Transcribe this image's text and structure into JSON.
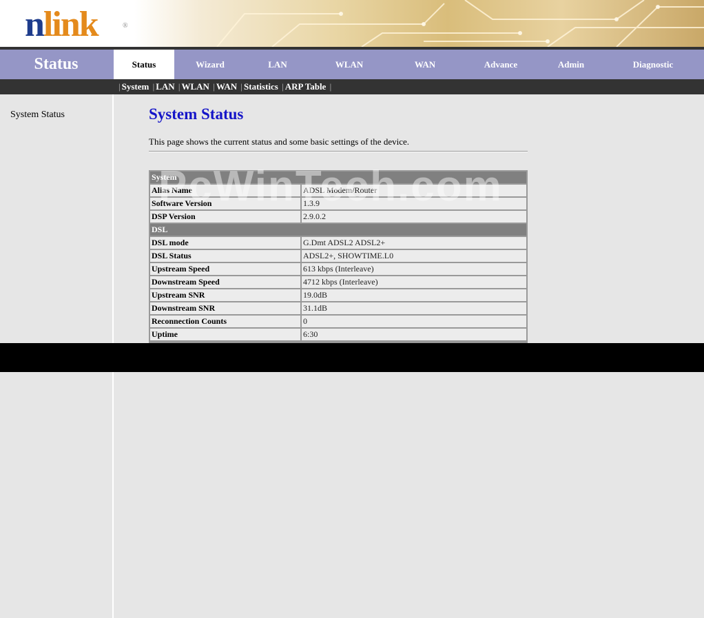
{
  "logo": {
    "n": "n",
    "link": "link",
    "reg": "®"
  },
  "section_title": "Status",
  "tabs": [
    {
      "label": "Status",
      "active": true
    },
    {
      "label": "Wizard"
    },
    {
      "label": "LAN"
    },
    {
      "label": "WLAN"
    },
    {
      "label": "WAN"
    },
    {
      "label": "Advance"
    },
    {
      "label": "Admin"
    },
    {
      "label": "Diagnostic"
    }
  ],
  "subnav": [
    "System",
    "LAN",
    "WLAN",
    "WAN",
    "Statistics",
    "ARP Table"
  ],
  "sidebar": {
    "item": "System Status"
  },
  "page": {
    "title": "System Status",
    "description": "This page shows the current status and some basic settings of the device."
  },
  "table": {
    "system_header": "System",
    "dsl_header": "DSL",
    "rows": [
      {
        "k": "Alias Name",
        "v": "ADSL Modem/Router"
      },
      {
        "k": "Software Version",
        "v": "1.3.9"
      },
      {
        "k": "DSP Version",
        "v": "2.9.0.2"
      },
      {
        "k": "DSL mode",
        "v": "G.Dmt ADSL2 ADSL2+"
      },
      {
        "k": "DSL Status",
        "v": "ADSL2+, SHOWTIME.L0"
      },
      {
        "k": "Upstream Speed",
        "v": "613 kbps  (Interleave)"
      },
      {
        "k": "Downstream Speed",
        "v": "4712 kbps  (Interleave)"
      },
      {
        "k": "Upstream SNR",
        "v": "19.0dB"
      },
      {
        "k": "Downstream SNR",
        "v": "31.1dB"
      },
      {
        "k": "Reconnection Counts",
        "v": "0"
      },
      {
        "k": "Uptime",
        "v": "6:30"
      }
    ]
  },
  "watermark": "PcWinTech.com",
  "colors": {
    "nav": "#9596c6",
    "subnav": "#333333",
    "title": "#1515c8",
    "section": "#808080"
  }
}
